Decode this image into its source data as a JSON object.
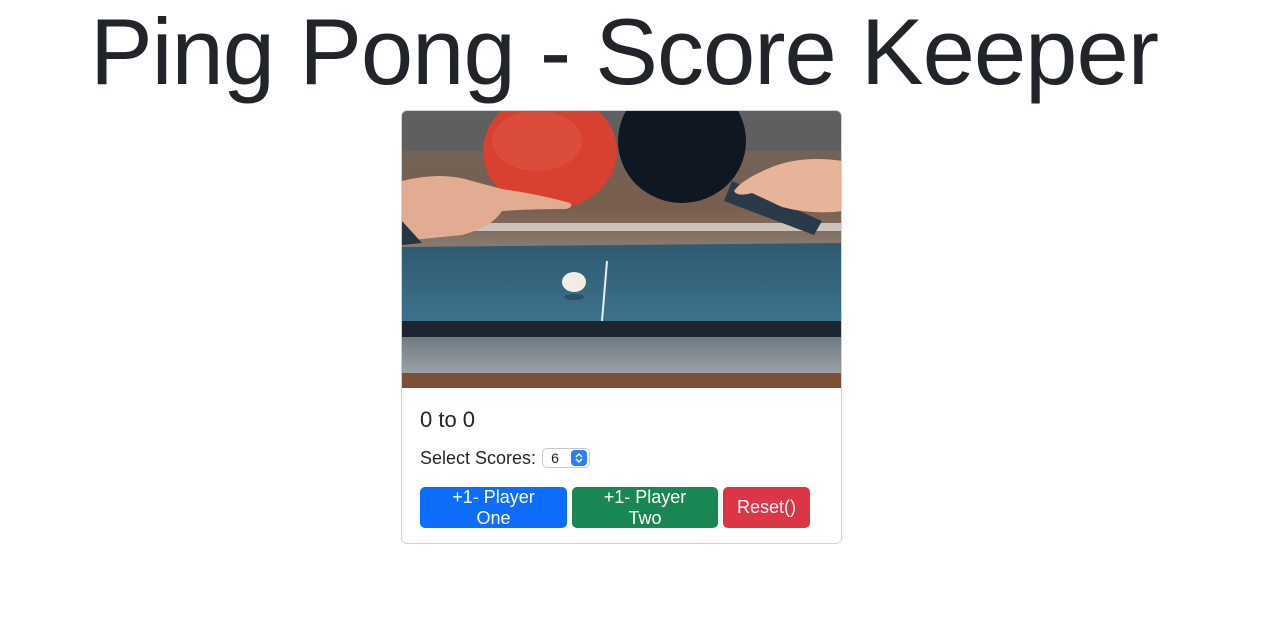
{
  "header": {
    "title": "Ping Pong - Score Keeper"
  },
  "card": {
    "image": {
      "name": "ping-pong-paddles-photo",
      "colors": {
        "red_paddle": "#d8402f",
        "black_paddle": "#0f1723",
        "table": "#3f6f86",
        "background": "#7a5a44"
      }
    },
    "score": {
      "text": "0 to 0",
      "player_one": 0,
      "player_two": 0
    },
    "select": {
      "label": "Select Scores:",
      "value": "6"
    },
    "buttons": {
      "player_one": "+1- Player One",
      "player_two": "+1- Player Two",
      "reset": "Reset()"
    }
  },
  "colors": {
    "primary": "#0d6efd",
    "success": "#198754",
    "danger": "#dc3545",
    "text": "#212529"
  }
}
